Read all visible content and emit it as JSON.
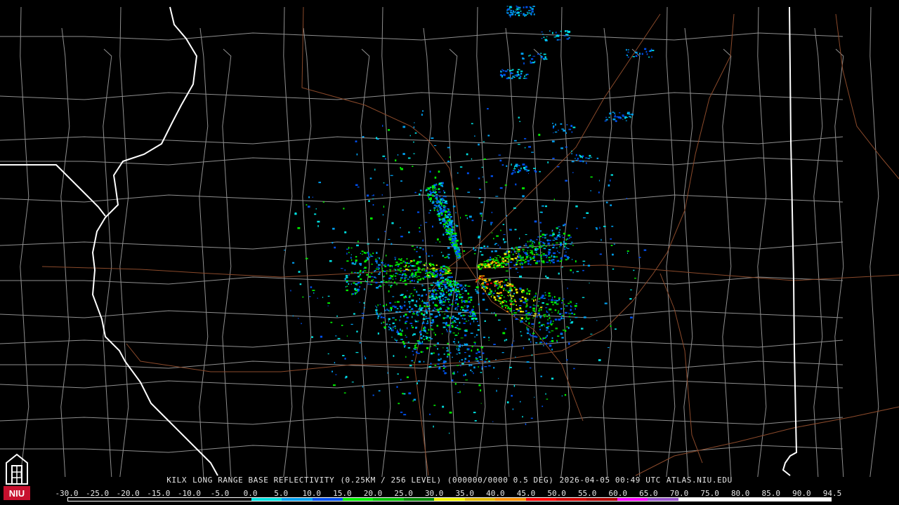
{
  "caption": {
    "station": "KILX",
    "product": "LONG RANGE BASE REFLECTIVITY",
    "resolution": "(0.25KM / 256 LEVEL)",
    "volume": "(000000/0000 0.5 DEG)",
    "timestamp": "2026-04-05 00:49 UTC",
    "source": "ATLAS.NIU.EDU"
  },
  "logo": {
    "text": "NIU",
    "icon": "university-tower-icon",
    "color": "#c8102e"
  },
  "colorbar": {
    "labels": [
      "-30.0",
      "-25.0",
      "-20.0",
      "-15.0",
      "-10.0",
      "-5.0",
      "0.0",
      "5.0",
      "10.0",
      "15.0",
      "20.0",
      "25.0",
      "30.0",
      "35.0",
      "40.0",
      "45.0",
      "50.0",
      "55.0",
      "60.0",
      "65.0",
      "70.0",
      "75.0",
      "80.0",
      "85.0",
      "90.0",
      "94.5"
    ],
    "colors": [
      "#000000",
      "#000000",
      "#000000",
      "#000000",
      "#000000",
      "#000000",
      "#00e0e0",
      "#00a0f0",
      "#0050f0",
      "#00f000",
      "#00c000",
      "#008800",
      "#f0f000",
      "#e0b800",
      "#ff9000",
      "#ff0000",
      "#d00000",
      "#b00000",
      "#ff00ff",
      "#9955cc",
      "#ffffff",
      "#ffffff",
      "#ffffff",
      "#ffffff",
      "#ffffff"
    ]
  },
  "colors": {
    "background": "#000000",
    "county_lines": "#8f8f8f",
    "state_lines": "#ffffff",
    "highways": "#8b4a2b"
  }
}
